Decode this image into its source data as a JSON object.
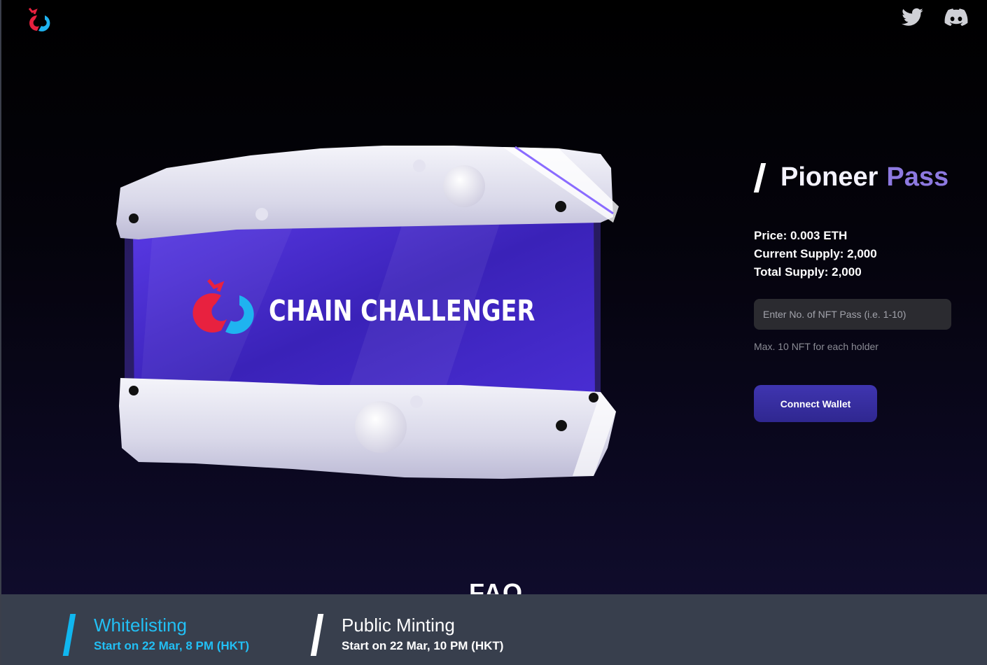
{
  "header": {
    "logo_icon": "chain-challenger-dragon-logo",
    "twitter_icon": "twitter-icon",
    "discord_icon": "discord-icon"
  },
  "card": {
    "brand_text": "CHAIN CHALLENGER",
    "accent_color": "#3a22b8"
  },
  "pass": {
    "title_part1": "Pioneer",
    "title_part2": "Pass",
    "title_accent_color": "#8d79e0",
    "price": "Price: 0.003 ETH",
    "current_supply": "Current Supply: 2,000",
    "total_supply": "Total Supply: 2,000",
    "input_placeholder": "Enter No. of NFT Pass (i.e. 1-10)",
    "input_value": "",
    "hint": "Max. 10 NFT for each holder",
    "connect_label": "Connect Wallet",
    "button_color": "#3b31a6"
  },
  "faq": {
    "heading": "FAQ"
  },
  "phases": [
    {
      "name": "Whitelisting",
      "date": "Start on 22 Mar, 8 PM (HKT)",
      "color": "#22bff4"
    },
    {
      "name": "Public Minting",
      "date": "Start on 22 Mar, 10 PM (HKT)",
      "color": "#ffffff"
    }
  ]
}
